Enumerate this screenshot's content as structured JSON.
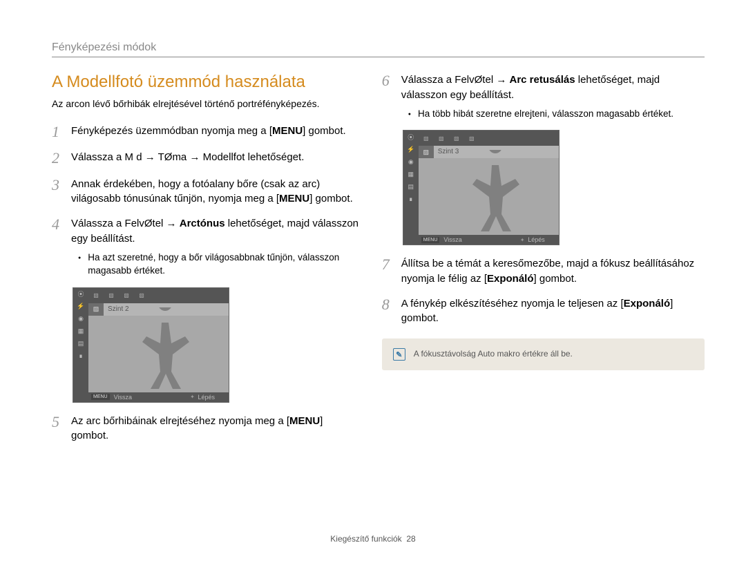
{
  "header": {
    "breadcrumb": "Fényképezési módok"
  },
  "title": "A Modellfotó üzemmód használata",
  "intro": "Az arcon lévő bőrhibák elrejtésével történő portréfényképezés.",
  "steps": {
    "s1": {
      "num": "1",
      "pre": "Fényképezés üzemmódban nyomja meg a [",
      "bold": "MENU",
      "post": "] gombot."
    },
    "s2": {
      "num": "2",
      "text": "Válassza a M d → TØma → Modellfot  lehetőséget."
    },
    "s3": {
      "num": "3",
      "pre": "Annak érdekében, hogy a fotóalany bőre (csak az arc) világosabb tónusúnak tűnjön, nyomja meg a [",
      "bold": "MENU",
      "post": "] gombot."
    },
    "s4": {
      "num": "4",
      "pre": "Válassza a FelvØtel → ",
      "bold": "Arctónus",
      "post": " lehetőséget, majd válasszon egy beállítást.",
      "sub": "Ha azt szeretné, hogy a bőr világosabbnak tűnjön, válasszon magasabb értéket."
    },
    "s5": {
      "num": "5",
      "pre": "Az arc bőrhibáinak elrejtéséhez nyomja meg a [",
      "bold": "MENU",
      "post": "] gombot."
    },
    "s6": {
      "num": "6",
      "pre": "Válassza a FelvØtel → ",
      "bold": "Arc retusálás",
      "post": " lehetőséget, majd válasszon egy beállítást.",
      "sub": "Ha több hibát szeretne elrejteni, válasszon magasabb értéket."
    },
    "s7": {
      "num": "7",
      "pre": "Állítsa be a témát a keresőmezőbe, majd a fókusz beállításához nyomja le félig az [",
      "bold": "Exponáló",
      "post": "] gombot."
    },
    "s8": {
      "num": "8",
      "pre": "A fénykép elkészítéséhez nyomja le teljesen az [",
      "bold": "Exponáló",
      "post": "] gombot."
    }
  },
  "mock1": {
    "level": "Szint 2",
    "menu": "MENU",
    "back": "Vissza",
    "step": "Lépés"
  },
  "mock2": {
    "level": "Szint 3",
    "menu": "MENU",
    "back": "Vissza",
    "step": "Lépés"
  },
  "note": {
    "text": "A fókusztávolság Auto makro értékre áll be."
  },
  "footer": {
    "section": "Kiegészítő funkciók",
    "page": "28"
  }
}
